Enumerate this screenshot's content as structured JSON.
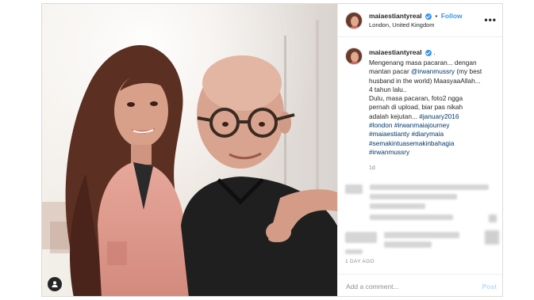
{
  "header": {
    "username": "maiaestiantyreal",
    "follow_label": "Follow",
    "separator": "•",
    "location": "London, United Kingdom",
    "more_label": "•••"
  },
  "caption": {
    "username": "maiaestiantyreal",
    "after_verified": ".",
    "lines": [
      {
        "text": "Mengenang masa pacaran... dengan"
      },
      {
        "pre": "mantan pacar ",
        "link": "@irwanmussry",
        "post": " (my best"
      },
      {
        "text": "husband in the world) MaasyaaAllah..."
      },
      {
        "text": "4 tahun lalu.."
      },
      {
        "text": "Dulu, masa pacaran, foto2 ngga"
      },
      {
        "text": "pernah di upload, biar pas nikah"
      },
      {
        "pre": "adalah kejutan... ",
        "link": "#january2016",
        "post": ""
      },
      {
        "link": "#london",
        "post": " ",
        "link2": "#irwanmaiajourney"
      },
      {
        "link": "#maiaestianty",
        "post": " ",
        "link2": "#diarymaia"
      },
      {
        "link": "#semakintuasemakinbahagia"
      },
      {
        "link": "#irwanmussry"
      }
    ],
    "time": "1d"
  },
  "date_label": "1 DAY AGO",
  "add_comment": {
    "placeholder": "Add a comment...",
    "post_label": "Post"
  },
  "colors": {
    "link": "#00376b",
    "accent": "#3897f0",
    "post_disabled": "#b2dffc"
  }
}
